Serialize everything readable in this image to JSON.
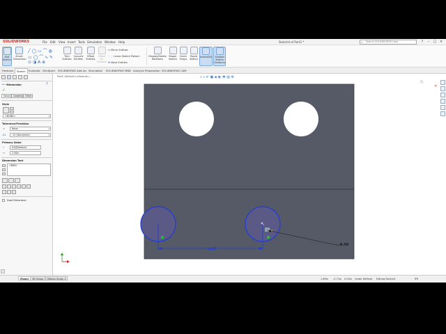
{
  "app": {
    "logo": "SOLIDWORKS",
    "menu": [
      "File",
      "Edit",
      "View",
      "Insert",
      "Tools",
      "Simulation",
      "Window",
      "Help"
    ],
    "doc_title": "Sketch4 of Part2 *",
    "search_placeholder": "Search SOLIDWORKS Help",
    "win_buttons": [
      "?",
      "–",
      "□",
      "×"
    ]
  },
  "ribbon": {
    "buttons": [
      {
        "label": "Exit Sketch",
        "active": true
      },
      {
        "label": "Smart Dimension"
      },
      {
        "label": "Trim Entities"
      },
      {
        "label": "Convert Entities"
      },
      {
        "label": "Offset Entities"
      },
      {
        "label": "Offset On Surface"
      },
      {
        "label": "Display/Delete Relations"
      },
      {
        "label": "Repair Sketch"
      },
      {
        "label": "Quick Snaps"
      },
      {
        "label": "Rapid Sketch"
      },
      {
        "label": "Instant2D",
        "active": true
      },
      {
        "label": "Shaded Sketch Contours",
        "active": true
      }
    ],
    "small_items": [
      "Mirror Entities",
      "Linear Sketch Pattern",
      "Move Entities"
    ]
  },
  "tabs": [
    "Features",
    "Sketch",
    "Evaluate",
    "DimXpert",
    "SOLIDWORKS Add-Ins",
    "Simulation",
    "SOLIDWORKS MBD",
    "Analysis Preparation",
    "SOLIDWORKS CAM"
  ],
  "active_tab": "Sketch",
  "breadcrumb": "Part2 (Default<<Default>...",
  "panel": {
    "title": "Dimension",
    "subtabs": [
      "Value",
      "Leaders",
      "Other"
    ],
    "style_label": "Style",
    "style_value": "<NONE>",
    "tolerance_label": "Tolerance/Precision",
    "tolerance_type": "None",
    "precision": ".12 (Document)",
    "primary_label": "Primary Value",
    "primary_name": "D1@Sketch4",
    "primary_value": "2.50in",
    "dimtext_label": "Dimension Text",
    "dimtext_value": "<DIM>",
    "dual_label": "Dual Dimension"
  },
  "drawing": {
    "dim_horizontal": "1.20",
    "dim_leader": "0.50",
    "face_color": "#565a66",
    "sketch_color": "#1f3bd6"
  },
  "status": {
    "bottom_tabs": [
      "Model",
      "3D Views",
      "Motion Study 1"
    ],
    "active_tab": "Model",
    "coords": "1.69in",
    "coords2": "-0.71in",
    "coords3": "0.00in",
    "state": "Under Defined",
    "editing": "Editing Sketch4",
    "units": "IPS"
  }
}
